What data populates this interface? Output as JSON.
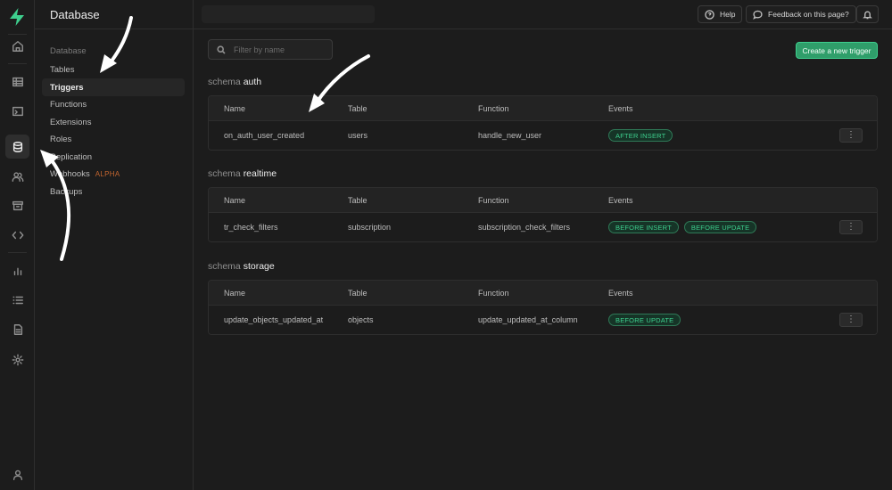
{
  "rail": {
    "items": [
      {
        "name": "home-icon"
      },
      {
        "name": "table-editor-icon"
      },
      {
        "name": "sql-editor-icon"
      },
      {
        "name": "database-icon"
      },
      {
        "name": "auth-users-icon"
      },
      {
        "name": "storage-icon"
      },
      {
        "name": "edge-functions-icon"
      },
      {
        "name": "reports-icon"
      },
      {
        "name": "logs-icon"
      },
      {
        "name": "api-docs-icon"
      },
      {
        "name": "settings-icon"
      },
      {
        "name": "user-icon"
      }
    ]
  },
  "sidebar": {
    "title": "Database",
    "group": "Database",
    "items": [
      {
        "label": "Tables"
      },
      {
        "label": "Triggers"
      },
      {
        "label": "Functions"
      },
      {
        "label": "Extensions"
      },
      {
        "label": "Roles"
      },
      {
        "label": "Replication"
      },
      {
        "label": "Webhooks",
        "badge": "ALPHA"
      },
      {
        "label": "Backups"
      }
    ]
  },
  "topbar": {
    "help": "Help",
    "feedback": "Feedback on this page?"
  },
  "main": {
    "filter_placeholder": "Filter by name",
    "create_button": "Create a new trigger",
    "columns": {
      "name": "Name",
      "table": "Table",
      "function": "Function",
      "events": "Events"
    },
    "schemas": [
      {
        "prefix": "schema",
        "name": "auth",
        "row": {
          "name": "on_auth_user_created",
          "table": "users",
          "function": "handle_new_user",
          "events": [
            "AFTER INSERT"
          ]
        }
      },
      {
        "prefix": "schema",
        "name": "realtime",
        "row": {
          "name": "tr_check_filters",
          "table": "subscription",
          "function": "subscription_check_filters",
          "events": [
            "BEFORE INSERT",
            "BEFORE UPDATE"
          ]
        }
      },
      {
        "prefix": "schema",
        "name": "storage",
        "row": {
          "name": "update_objects_updated_at",
          "table": "objects",
          "function": "update_updated_at_column",
          "events": [
            "BEFORE UPDATE"
          ]
        }
      }
    ]
  },
  "colors": {
    "accent": "#3ecf8e",
    "background": "#1c1c1c",
    "border": "#2e2e2e"
  }
}
